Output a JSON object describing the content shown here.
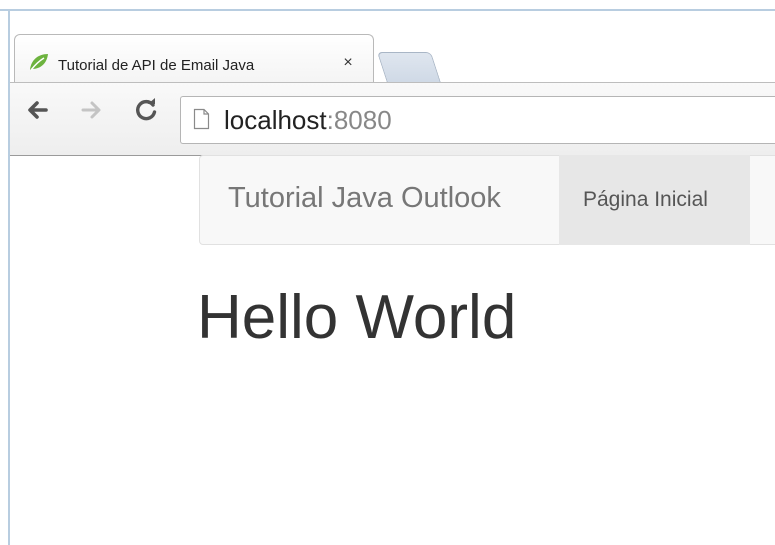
{
  "browser": {
    "tab": {
      "title": "Tutorial de API de Email Java",
      "close_glyph": "×",
      "favicon": "spring-leaf-icon"
    },
    "address_bar": {
      "host": "localhost",
      "port": ":8080"
    },
    "icons": {
      "back": "back-arrow-icon",
      "forward": "forward-arrow-icon",
      "reload": "reload-icon",
      "page": "page-icon"
    },
    "colors": {
      "frame": "#b8cde0",
      "favicon_green": "#6db33f"
    }
  },
  "page": {
    "navbar": {
      "brand": "Tutorial Java Outlook",
      "items": [
        {
          "label": "Página Inicial",
          "active": true
        }
      ]
    },
    "headline": "Hello World"
  }
}
